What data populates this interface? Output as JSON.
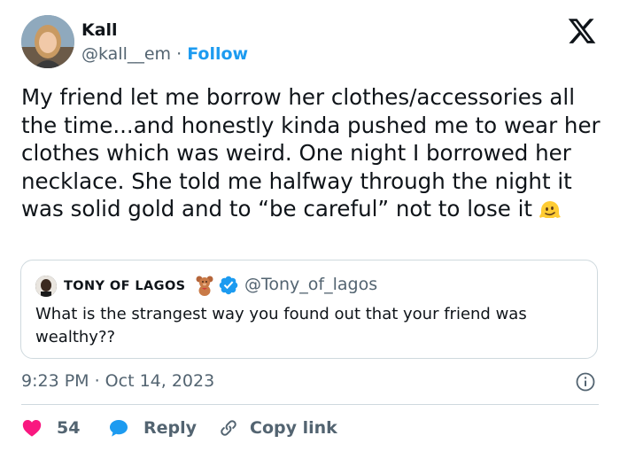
{
  "author": {
    "name": "Kall",
    "handle": "@kall__em",
    "separator": "·",
    "follow_label": "Follow"
  },
  "tweet": {
    "text": "My friend let me borrow her clothes/accessories all the time...and honestly kinda pushed me to wear her clothes which was weird. One night I borrowed her necklace. She told me halfway through the night it was solid gold and to “be careful” not to lose it",
    "emoji": "melting-face-emoji"
  },
  "quoted_tweet": {
    "name": "TONY OF LAGOS",
    "emoji": "teddy-bear-emoji",
    "verified": true,
    "handle": "@Tony_of_lagos",
    "text": "What is the strangest way you found out that your friend was wealthy??"
  },
  "meta": {
    "timestamp": "9:23 PM · Oct 14, 2023"
  },
  "actions": {
    "like_count": "54",
    "reply_label": "Reply",
    "copy_label": "Copy link"
  },
  "colors": {
    "accent": "#1d9bf0",
    "like": "#f91880",
    "secondary_text": "#536471",
    "border": "#cfd9de"
  }
}
